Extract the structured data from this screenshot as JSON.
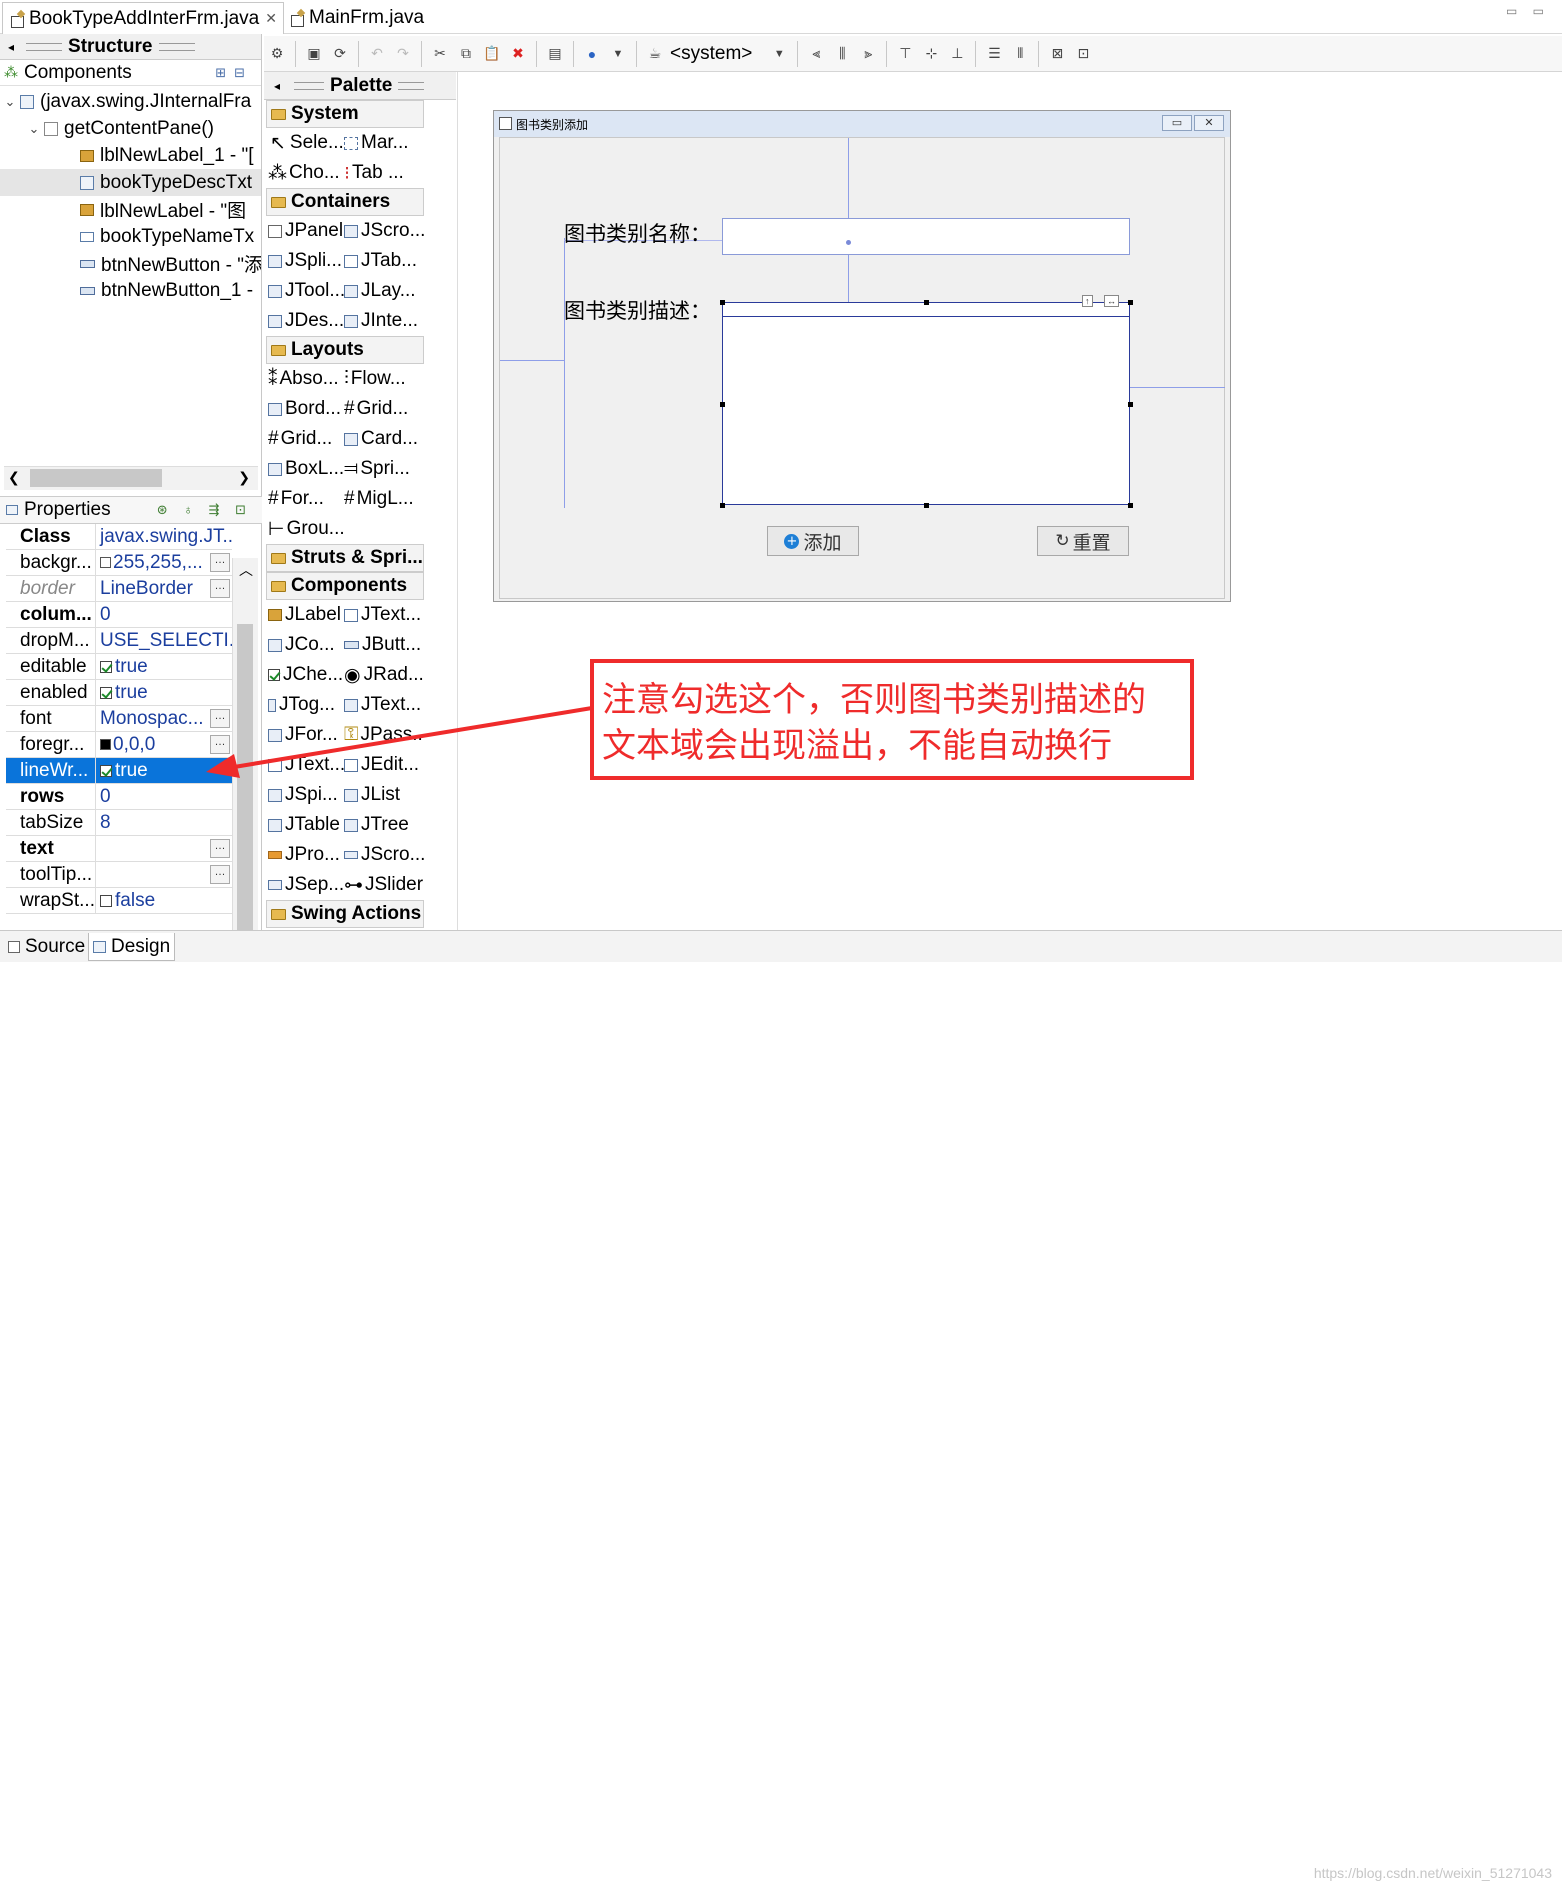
{
  "tabs": [
    {
      "label": "BookTypeAddInterFrm.java",
      "close": "✕"
    },
    {
      "label": "MainFrm.java"
    }
  ],
  "window_controls": "▭ ▭",
  "structure": {
    "title": "Structure",
    "components_label": "Components",
    "tree": [
      "(javax.swing.JInternalFra",
      "getContentPane()",
      "lblNewLabel_1 - \"[",
      "bookTypeDescTxt",
      "lblNewLabel - \"图",
      "bookTypeNameTx",
      "btnNewButton - \"添",
      "btnNewButton_1 -"
    ]
  },
  "properties": {
    "title": "Properties",
    "rows": [
      {
        "name": "Class",
        "value": "javax.swing.JT..."
      },
      {
        "name": "backgr...",
        "value": "255,255,..."
      },
      {
        "name": "border",
        "value": "LineBorder"
      },
      {
        "name": "colum...",
        "value": "0"
      },
      {
        "name": "dropM...",
        "value": "USE_SELECTI..."
      },
      {
        "name": "editable",
        "value": "true"
      },
      {
        "name": "enabled",
        "value": "true"
      },
      {
        "name": "font",
        "value": "Monospac..."
      },
      {
        "name": "foregr...",
        "value": "0,0,0"
      },
      {
        "name": "lineWr...",
        "value": "true"
      },
      {
        "name": "rows",
        "value": "0"
      },
      {
        "name": "tabSize",
        "value": "8"
      },
      {
        "name": "text",
        "value": ""
      },
      {
        "name": "toolTip...",
        "value": ""
      },
      {
        "name": "wrapSt...",
        "value": "false"
      }
    ]
  },
  "toolbar": {
    "system_selector": "<system>"
  },
  "palette": {
    "title": "Palette",
    "categories": [
      {
        "name": "System",
        "items": [
          "Sele...",
          "Mar...",
          "Cho...",
          "Tab ..."
        ]
      },
      {
        "name": "Containers",
        "items": [
          "JPanel",
          "JScro...",
          "JSpli...",
          "JTab...",
          "JTool...",
          "JLay...",
          "JDes...",
          "JInte..."
        ]
      },
      {
        "name": "Layouts",
        "items": [
          "Abso...",
          "Flow...",
          "Bord...",
          "Grid...",
          "Grid...",
          "Card...",
          "BoxL...",
          "Spri...",
          "For...",
          "MigL...",
          "Grou..."
        ]
      },
      {
        "name": "Struts & Spri...",
        "items": []
      },
      {
        "name": "Components",
        "items": [
          "JLabel",
          "JText...",
          "JCo...",
          "JButt...",
          "JChe...",
          "JRad...",
          "JTog...",
          "JText...",
          "JFor...",
          "JPass...",
          "JText...",
          "JEdit...",
          "JSpi...",
          "JList",
          "JTable",
          "JTree",
          "JPro...",
          "JScro...",
          "JSep...",
          "JSlider"
        ]
      },
      {
        "name": "Swing Actions",
        "items": []
      }
    ]
  },
  "design_frame": {
    "title": "图书类别添加",
    "name_label": "图书类别名称：",
    "desc_label": "图书类别描述：",
    "add_button": "添加",
    "reset_button": "重置"
  },
  "bottom_tabs": [
    "Source",
    "Design"
  ],
  "annotation": {
    "line1": "注意勾选这个，否则图书类别描述的",
    "line2": "文本域会出现溢出，不能自动换行",
    "color": "#ef2b2b"
  },
  "watermark": "https://blog.csdn.net/weixin_51271043"
}
